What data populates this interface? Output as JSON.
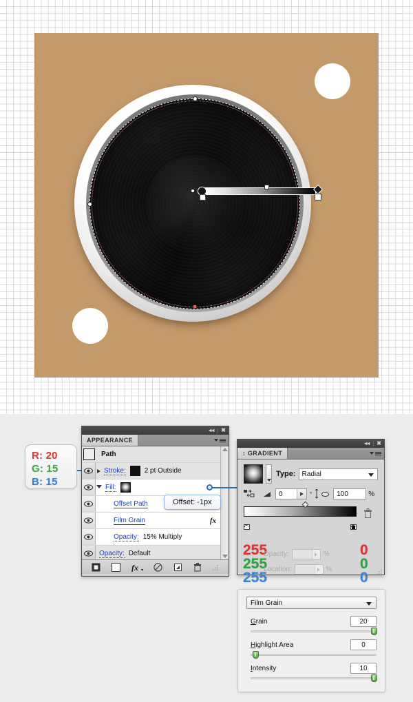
{
  "canvas": {
    "artboard_bg": "#c59a6b",
    "speaker": {
      "name": "speaker-cone-illustration",
      "gradient_annotator": {
        "type": "radial",
        "start_color": "#ffffff",
        "end_color": "#000000"
      }
    }
  },
  "rgb_callout": {
    "r": "R: 20",
    "g": "G: 15",
    "b": "B: 15",
    "colors": {
      "r": "#e03b3b",
      "g": "#3ea84a",
      "b": "#3d7fd6"
    }
  },
  "appearance_panel": {
    "tab_label": "APPEARANCE",
    "title": "Path",
    "rows": [
      {
        "label": "Stroke:",
        "value": "2 pt  Outside",
        "swatch": "black"
      },
      {
        "label": "Fill:",
        "value": "",
        "swatch": "gradient"
      },
      {
        "label": "Offset Path",
        "value": ""
      },
      {
        "label": "Film Grain",
        "value": "",
        "fx": "fx"
      },
      {
        "label": "Opacity:",
        "value": "15% Multiply"
      },
      {
        "label": "Opacity:",
        "value": "Default"
      }
    ],
    "footer_icons": [
      "add-new-stroke-icon",
      "add-new-fill-icon",
      "add-new-effect-icon",
      "clear-appearance-icon",
      "duplicate-item-icon",
      "delete-item-icon"
    ]
  },
  "offset_tooltip": {
    "text": "Offset: -1px"
  },
  "gradient_panel": {
    "tab_label": "GRADIENT",
    "type_label": "Type:",
    "type_value": "Radial",
    "angle_value": "0",
    "angle_unit": "°",
    "aspect_value": "100",
    "aspect_unit": "%",
    "opacity_label": "Opacity:",
    "location_label": "Location:",
    "percent_sign": "%",
    "left_stop": {
      "r": "255",
      "g": "255",
      "b": "255"
    },
    "right_stop": {
      "r": "0",
      "g": "0",
      "b": "0"
    },
    "colors": {
      "r": "#e03030",
      "g": "#2fa23f",
      "b": "#3d84d6"
    }
  },
  "filmgrain_panel": {
    "effect_name": "Film Grain",
    "sliders": [
      {
        "label": "Grain",
        "value": "20",
        "percent": 96
      },
      {
        "label": "Highlight Area",
        "value": "0",
        "percent": 1
      },
      {
        "label": "Intensity",
        "value": "10",
        "percent": 96
      }
    ]
  }
}
